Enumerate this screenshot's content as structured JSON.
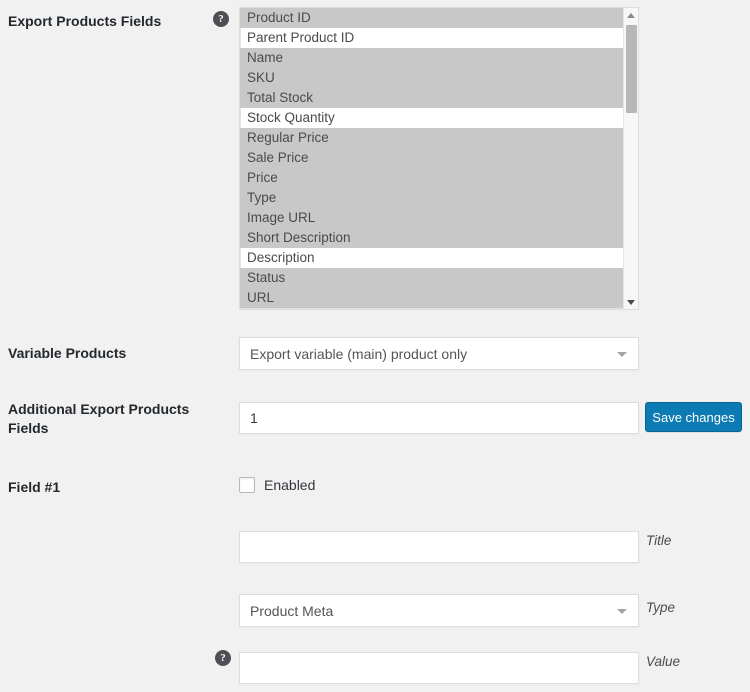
{
  "page": {
    "background": "#f1f1f1",
    "accent": "#0c7bb3"
  },
  "rows": {
    "export_products_fields": {
      "label": "Export Products Fields",
      "help_icon": "help-icon",
      "help_glyph": "?",
      "options": [
        {
          "label": "Product ID",
          "selected": true
        },
        {
          "label": "Parent Product ID",
          "selected": false
        },
        {
          "label": "Name",
          "selected": true
        },
        {
          "label": "SKU",
          "selected": true
        },
        {
          "label": "Total Stock",
          "selected": true
        },
        {
          "label": "Stock Quantity",
          "selected": false
        },
        {
          "label": "Regular Price",
          "selected": true
        },
        {
          "label": "Sale Price",
          "selected": true
        },
        {
          "label": "Price",
          "selected": true
        },
        {
          "label": "Type",
          "selected": true
        },
        {
          "label": "Image URL",
          "selected": true
        },
        {
          "label": "Short Description",
          "selected": true
        },
        {
          "label": "Description",
          "selected": false
        },
        {
          "label": "Status",
          "selected": true
        },
        {
          "label": "URL",
          "selected": true
        }
      ],
      "scrollbar": {
        "up_arrow_icon": "chevron-up-icon",
        "down_arrow_icon": "chevron-down-icon"
      }
    },
    "variable_products": {
      "label": "Variable Products",
      "selected_value": "Export variable (main) product only",
      "caret_icon": "chevron-down-icon"
    },
    "additional_export_products_fields": {
      "label": "Additional Export Products Fields",
      "value": "1",
      "placeholder": ""
    },
    "save_changes": {
      "label": "Save changes"
    },
    "field_1": {
      "label": "Field #1",
      "enabled_label": "Enabled",
      "enabled_checked": false,
      "title": {
        "value": "",
        "placeholder": "",
        "side_label": "Title"
      },
      "type": {
        "selected_value": "Product Meta",
        "side_label": "Type",
        "caret_icon": "chevron-down-icon"
      },
      "value": {
        "value": "",
        "placeholder": "",
        "side_label": "Value",
        "help_icon": "help-icon",
        "help_glyph": "?"
      }
    }
  }
}
